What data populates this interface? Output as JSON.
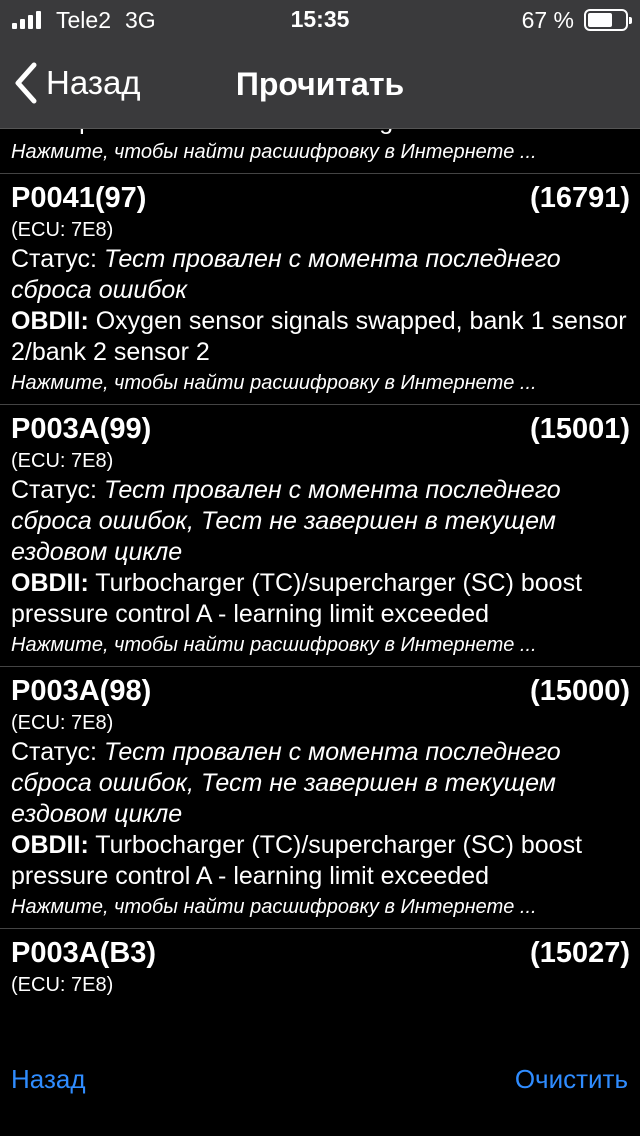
{
  "status_bar": {
    "carrier": "Tele2",
    "network": "3G",
    "time": "15:35",
    "battery": "67 %",
    "battery_level": 0.67
  },
  "nav": {
    "back_label": "Назад",
    "title": "Прочитать"
  },
  "partial_row": {
    "cut_text": "boost pressure control B - learning limit exceeded",
    "hint": "Нажмите, чтобы найти расшифровку в Интернете ..."
  },
  "rows": [
    {
      "code": "P0041(97)",
      "count": "(16791)",
      "ecu": "(ECU: 7E8)",
      "status_label": "Статус:",
      "status": "Тест провален с момента последнего сброса ошибок",
      "obd_label": "OBDII:",
      "obd": "Oxygen sensor signals swapped, bank 1 sensor 2/bank 2 sensor 2",
      "hint": "Нажмите, чтобы найти расшифровку в Интернете ..."
    },
    {
      "code": "P003A(99)",
      "count": "(15001)",
      "ecu": "(ECU: 7E8)",
      "status_label": "Статус:",
      "status": "Тест провален с момента последнего сброса ошибок, Тест не завершен в текущем ездовом цикле",
      "obd_label": "OBDII:",
      "obd": "Turbocharger (TC)/supercharger (SC) boost pressure control A - learning limit exceeded",
      "hint": "Нажмите, чтобы найти расшифровку в Интернете ..."
    },
    {
      "code": "P003A(98)",
      "count": "(15000)",
      "ecu": "(ECU: 7E8)",
      "status_label": "Статус:",
      "status": "Тест провален с момента последнего сброса ошибок, Тест не завершен в текущем ездовом цикле",
      "obd_label": "OBDII:",
      "obd": "Turbocharger (TC)/supercharger (SC) boost pressure control A - learning limit exceeded",
      "hint": "Нажмите, чтобы найти расшифровку в Интернете ..."
    },
    {
      "code": "P003A(B3)",
      "count": "(15027)",
      "ecu": "(ECU: 7E8)"
    }
  ],
  "bottom": {
    "back_label": "Назад",
    "clear_label": "Очистить"
  },
  "colors": {
    "bar_bg": "#3a3a3c",
    "accent": "#2f8cff",
    "background": "#000000"
  }
}
